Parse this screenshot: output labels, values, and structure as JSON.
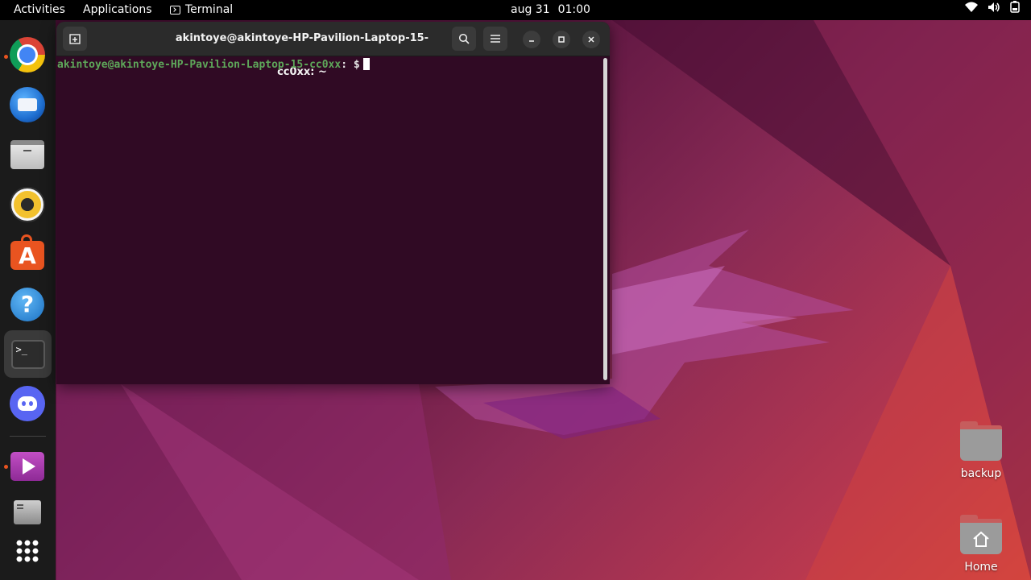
{
  "topbar": {
    "activities": "Activities",
    "applications": "Applications",
    "terminal": "Terminal",
    "date": "aug 31",
    "time": "01:00"
  },
  "dock": {
    "items": [
      {
        "name": "Google Chrome",
        "icon": "chrome-icon",
        "running": true
      },
      {
        "name": "Thunderbird Mail",
        "icon": "thunderbird-icon",
        "running": false
      },
      {
        "name": "Files",
        "icon": "files-icon",
        "running": false
      },
      {
        "name": "Rhythmbox",
        "icon": "rhythmbox-icon",
        "running": false
      },
      {
        "name": "Ubuntu Software",
        "icon": "software-store-icon",
        "running": false
      },
      {
        "name": "Help",
        "icon": "help-icon",
        "running": false
      },
      {
        "name": "Terminal",
        "icon": "terminal-icon",
        "running": true,
        "active": true
      },
      {
        "name": "Discord",
        "icon": "discord-icon",
        "running": false
      },
      {
        "name": "Video Player",
        "icon": "video-player-icon",
        "running": true
      },
      {
        "name": "Disks",
        "icon": "disk-icon",
        "running": false
      },
      {
        "name": "Show Applications",
        "icon": "app-grid-icon",
        "running": false
      }
    ]
  },
  "terminal": {
    "title": "akintoye@akintoye-HP-Pavilion-Laptop-15-cc0xx: ~",
    "prompt_user": "akintoye@akintoye-HP-Pavilion-Laptop-15-cc0xx",
    "prompt_sep": ":",
    "prompt_path": " ",
    "prompt_sign": "$",
    "colors": {
      "background": "#300a24",
      "user": "#5ea85a",
      "path": "#6f8fd6"
    }
  },
  "desktop": {
    "icons": [
      {
        "label": "backup",
        "icon": "folder-icon"
      },
      {
        "label": "Home",
        "icon": "home-folder-icon"
      }
    ]
  },
  "colors": {
    "accent": "#e95420",
    "dock_bg": "#1b1b1b",
    "topbar_bg": "#000000"
  }
}
